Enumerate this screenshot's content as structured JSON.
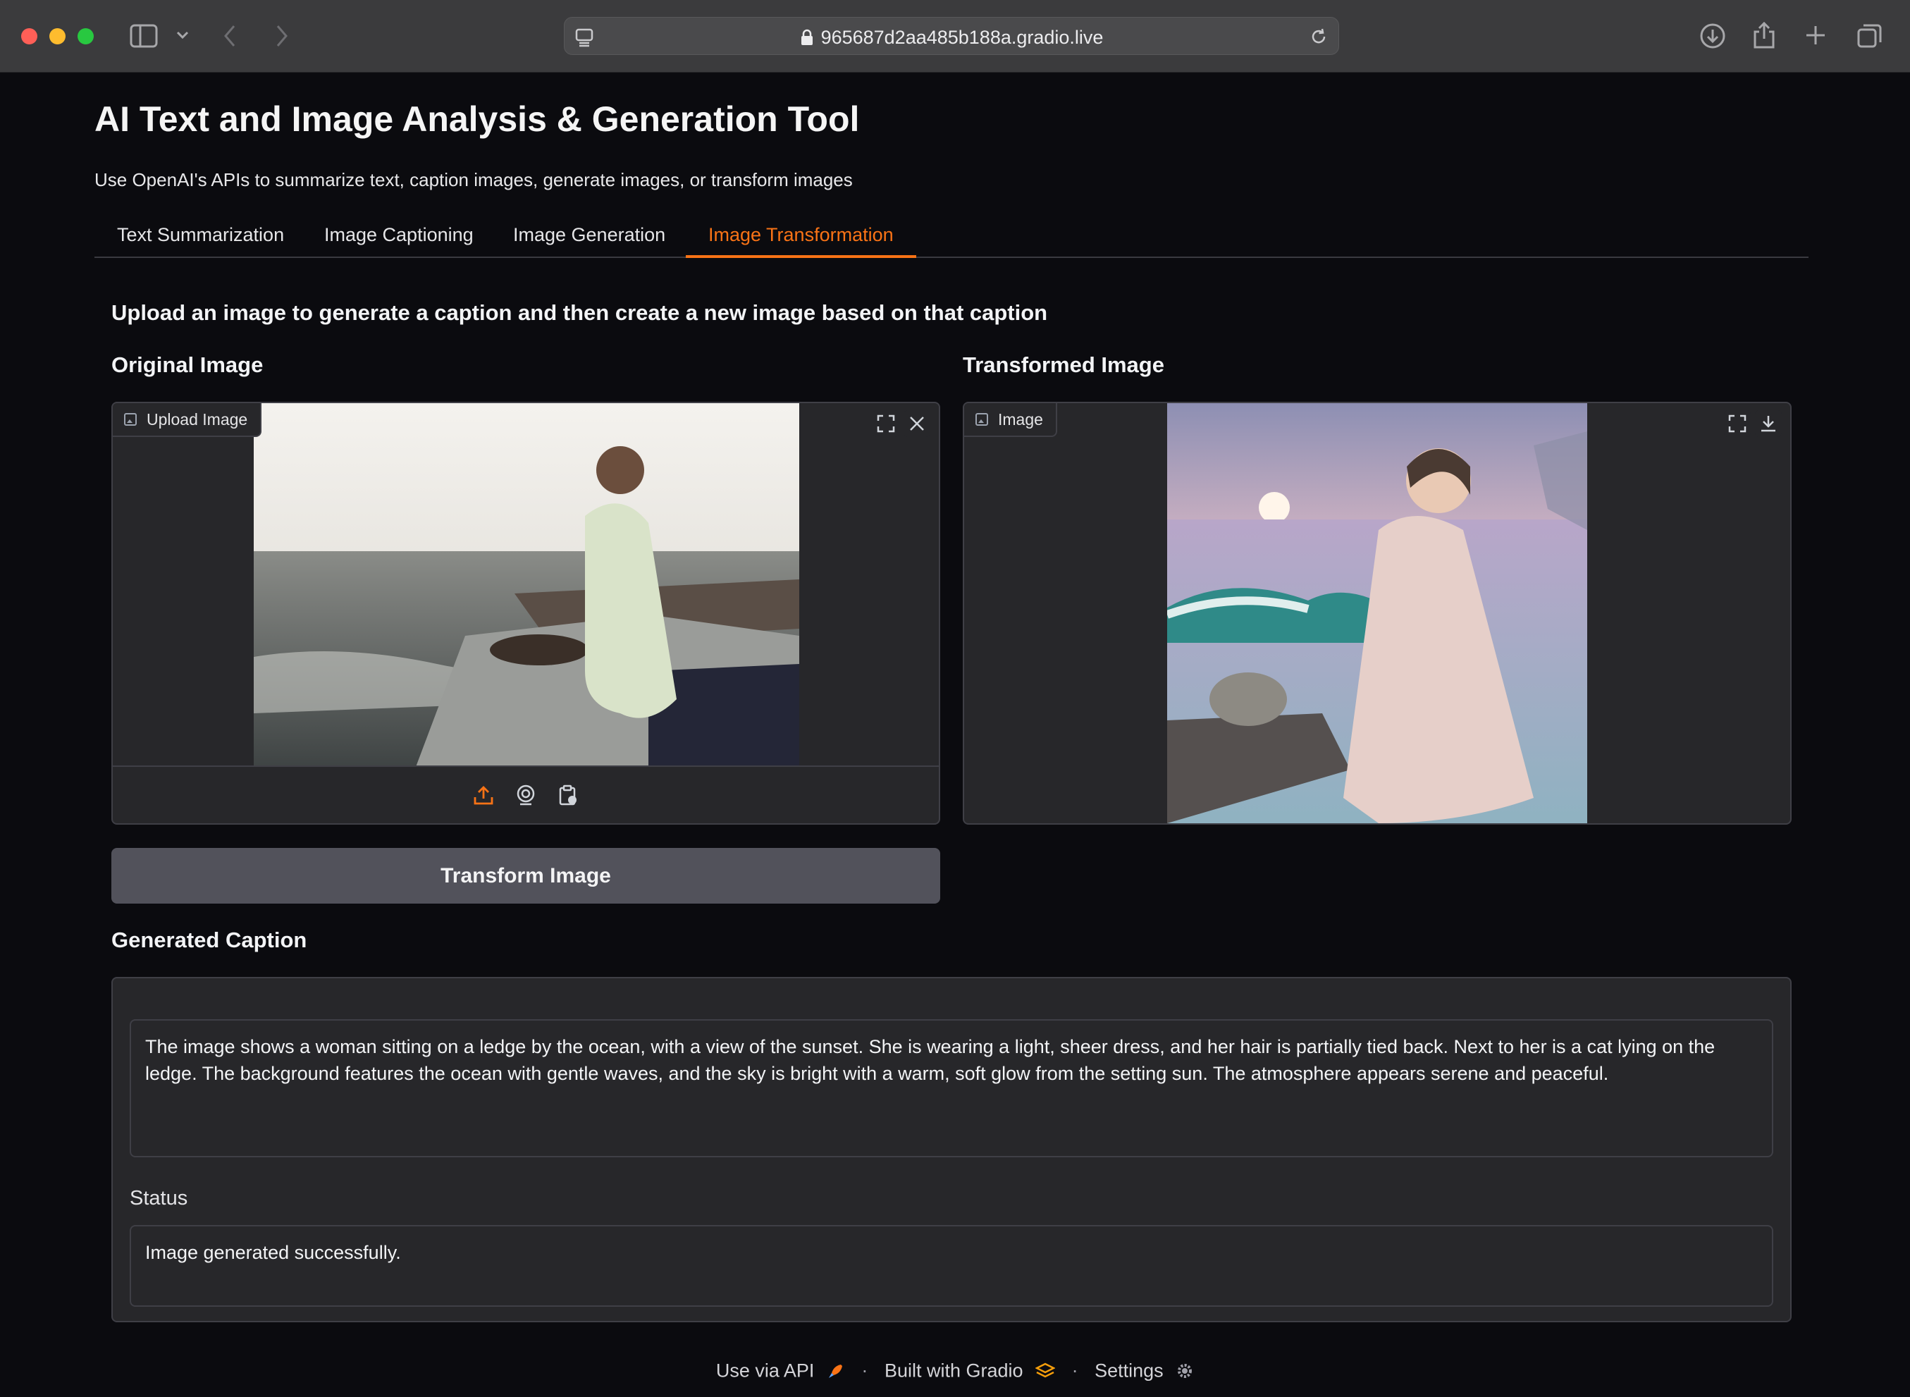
{
  "browser": {
    "url": "965687d2aa485b188a.gradio.live"
  },
  "page": {
    "title": "AI Text and Image Analysis & Generation Tool",
    "description": "Use OpenAI's APIs to summarize text, caption images, generate images, or transform images"
  },
  "tabs": [
    {
      "label": "Text Summarization"
    },
    {
      "label": "Image Captioning"
    },
    {
      "label": "Image Generation"
    },
    {
      "label": "Image Transformation"
    }
  ],
  "active_tab": "Image Transformation",
  "main": {
    "heading": "Upload an image to generate a caption and then create a new image based on that caption",
    "original": {
      "label": "Original Image",
      "chip": "Upload Image"
    },
    "transformed": {
      "label": "Transformed Image",
      "chip": "Image"
    },
    "transform_button": "Transform Image",
    "caption": {
      "label": "Generated Caption",
      "text": "The image shows a woman sitting on a ledge by the ocean, with a view of the sunset. She is wearing a light, sheer dress, and her hair is partially tied back. Next to her is a cat lying on the ledge. The background features the ocean with gentle waves, and the sky is bright with a warm, soft glow from the setting sun. The atmosphere appears serene and peaceful."
    },
    "status": {
      "label": "Status",
      "text": "Image generated successfully."
    }
  },
  "footer": {
    "api": "Use via API",
    "built": "Built with Gradio",
    "settings": "Settings"
  },
  "colors": {
    "accent": "#f97316",
    "background": "#0b0b0f",
    "panel": "#27272a",
    "button": "#52525b"
  }
}
